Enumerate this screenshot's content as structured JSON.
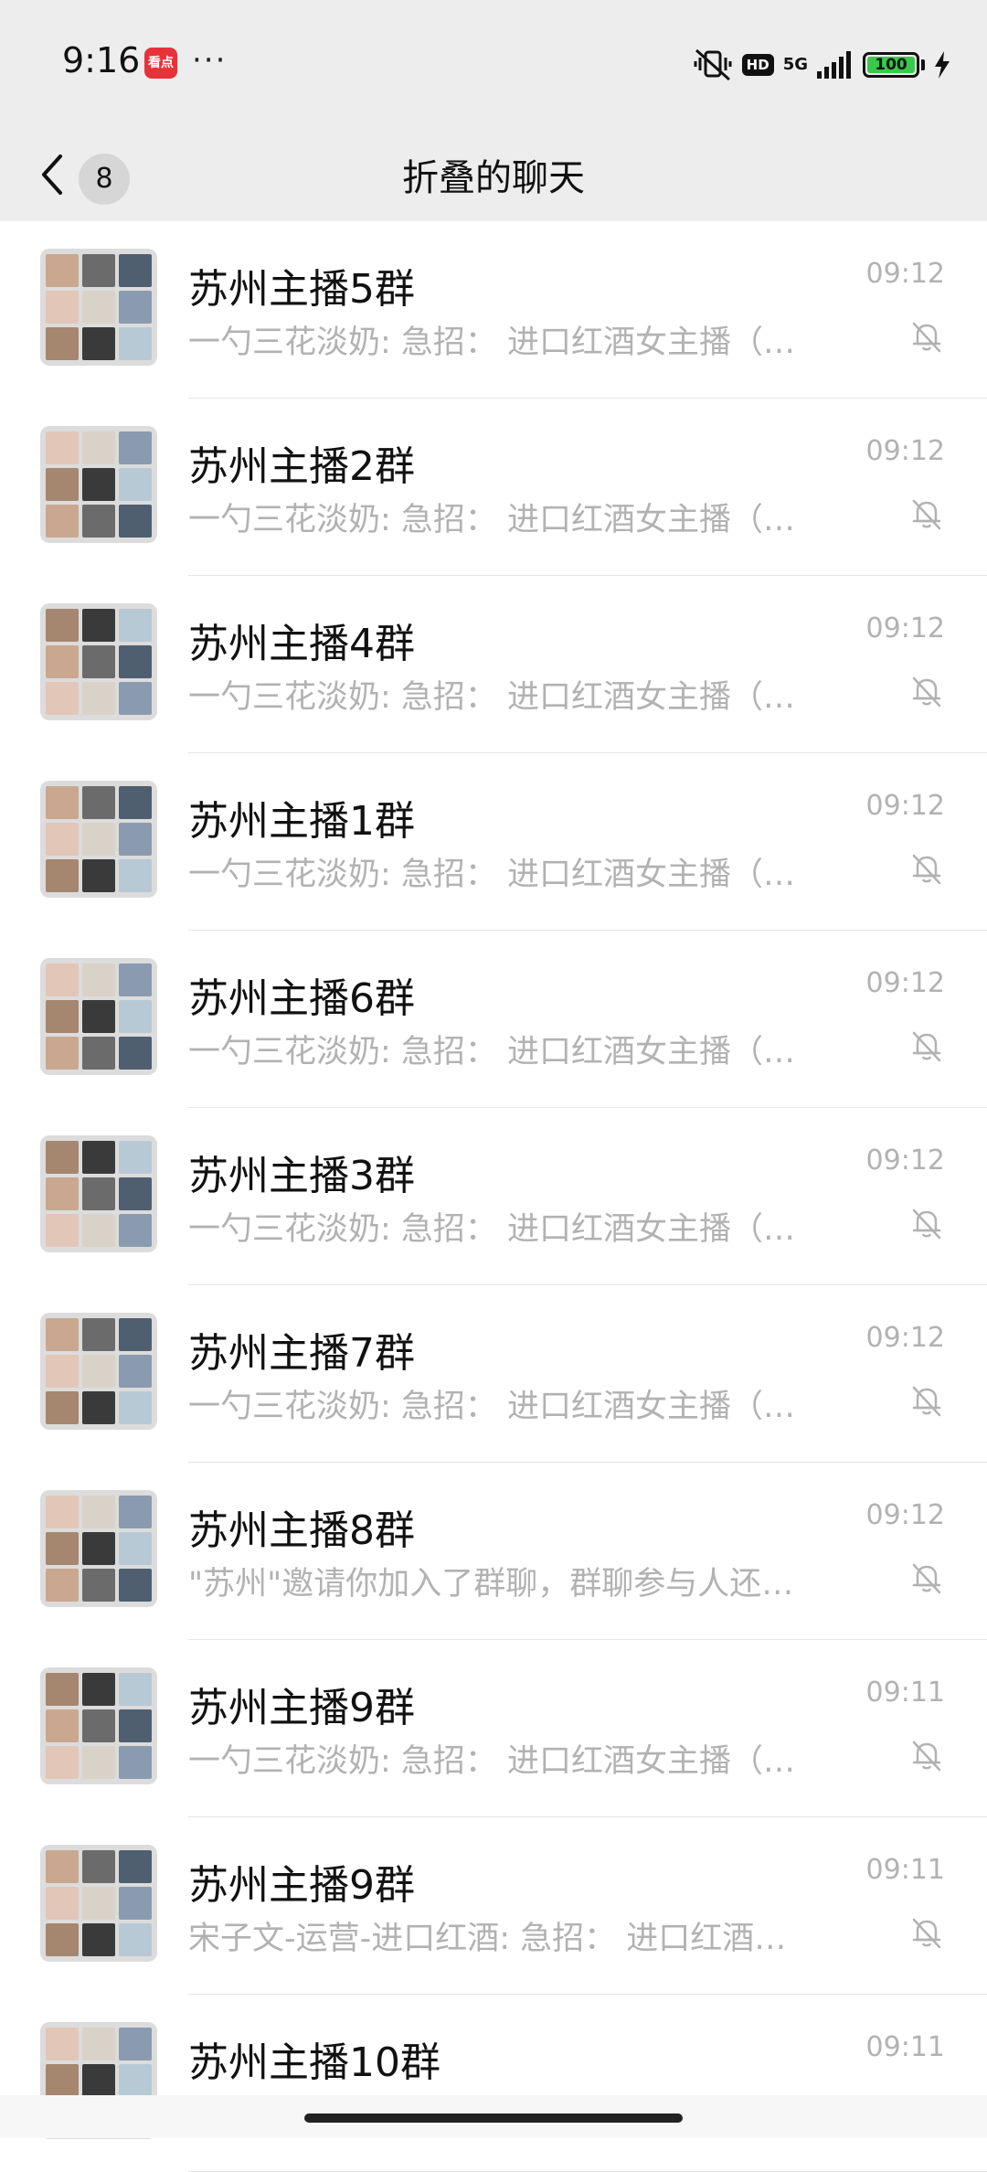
{
  "status_bar": {
    "time": "9:16",
    "app_badge": "看点",
    "dots": "···",
    "hd": "HD",
    "network": "5G",
    "battery": "100",
    "battery_color": "#38c94a"
  },
  "header": {
    "back_icon": "chevron-left-icon",
    "unread_count": "8",
    "title": "折叠的聊天"
  },
  "chats": [
    {
      "name": "苏州主播5群",
      "time": "09:12",
      "preview": "一勺三花淡奶: 急招： 进口红酒女主播（…"
    },
    {
      "name": "苏州主播2群",
      "time": "09:12",
      "preview": "一勺三花淡奶: 急招： 进口红酒女主播（…"
    },
    {
      "name": "苏州主播4群",
      "time": "09:12",
      "preview": "一勺三花淡奶: 急招： 进口红酒女主播（…"
    },
    {
      "name": "苏州主播1群",
      "time": "09:12",
      "preview": "一勺三花淡奶: 急招： 进口红酒女主播（…"
    },
    {
      "name": "苏州主播6群",
      "time": "09:12",
      "preview": "一勺三花淡奶: 急招： 进口红酒女主播（…"
    },
    {
      "name": "苏州主播3群",
      "time": "09:12",
      "preview": "一勺三花淡奶: 急招： 进口红酒女主播（…"
    },
    {
      "name": "苏州主播7群",
      "time": "09:12",
      "preview": "一勺三花淡奶: 急招： 进口红酒女主播（…"
    },
    {
      "name": "苏州主播8群",
      "time": "09:12",
      "preview": "\"苏州\"邀请你加入了群聊，群聊参与人还…"
    },
    {
      "name": "苏州主播9群",
      "time": "09:11",
      "preview": "一勺三花淡奶: 急招： 进口红酒女主播（…"
    },
    {
      "name": "苏州主播9群",
      "time": "09:11",
      "preview": "宋子文-运营-进口红酒: 急招： 进口红酒…"
    },
    {
      "name": "苏州主播10群",
      "time": "09:11",
      "preview": ""
    }
  ],
  "mute_icon": "bell-off-icon",
  "colors": {
    "header_bg": "#ededed",
    "secondary_text": "#b2b2b2"
  }
}
